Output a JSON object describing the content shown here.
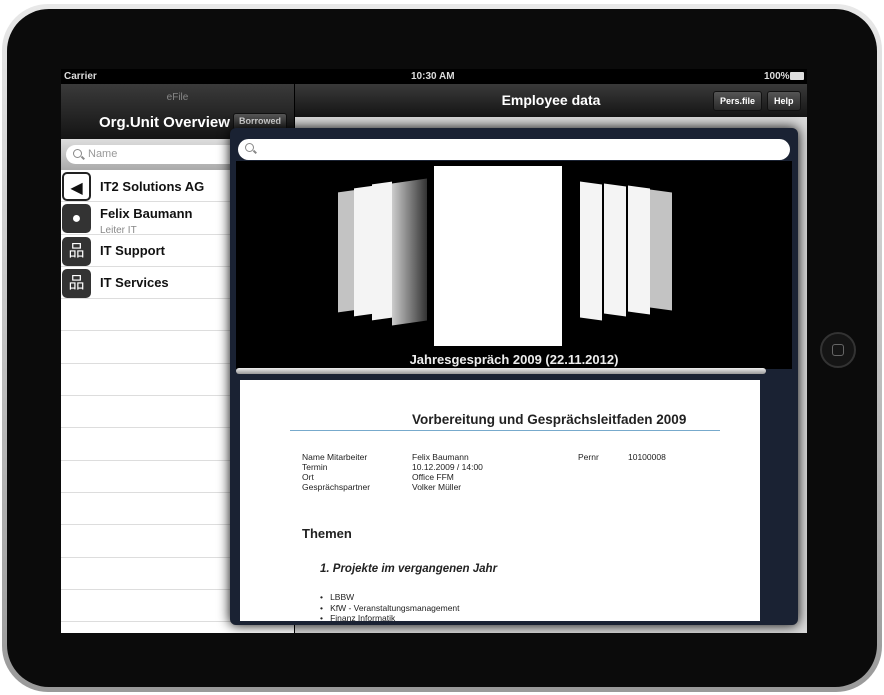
{
  "status": {
    "carrier": "Carrier",
    "time": "10:30 AM",
    "battery": "100%"
  },
  "left": {
    "app": "eFile",
    "title": "Org.Unit Overview",
    "borrowed": "Borrowed",
    "search_placeholder": "Name",
    "items": [
      {
        "title": "IT2 Solutions AG",
        "icon": "back-arrow-icon"
      },
      {
        "title": "Felix Baumann",
        "subtitle": "Leiter IT",
        "icon": "person-icon"
      },
      {
        "title": "IT Support",
        "icon": "org-chart-icon"
      },
      {
        "title": "IT Services",
        "icon": "org-chart-icon"
      }
    ]
  },
  "right": {
    "title": "Employee data",
    "pers_file": "Pers.file",
    "help": "Help"
  },
  "popover": {
    "search_value": "",
    "caption": "Jahresgespräch 2009 (22.11.2012)",
    "doc": {
      "title": "Vorbereitung und Gesprächsleitfaden 2009",
      "fields": [
        {
          "label": "Name Mitarbeiter",
          "value": "Felix Baumann"
        },
        {
          "label": "Termin",
          "value": "10.12.2009 / 14:00"
        },
        {
          "label": "Ort",
          "value": "Office FFM"
        },
        {
          "label": "Gesprächspartner",
          "value": "Volker Müller"
        }
      ],
      "pernr_label": "Pernr",
      "pernr_value": "10100008",
      "section": "Themen",
      "subsection": "1. Projekte im vergangenen Jahr",
      "bullets": [
        "LBBW",
        "KfW - Veranstaltungsmanagement",
        "Finanz Informatik"
      ]
    }
  }
}
